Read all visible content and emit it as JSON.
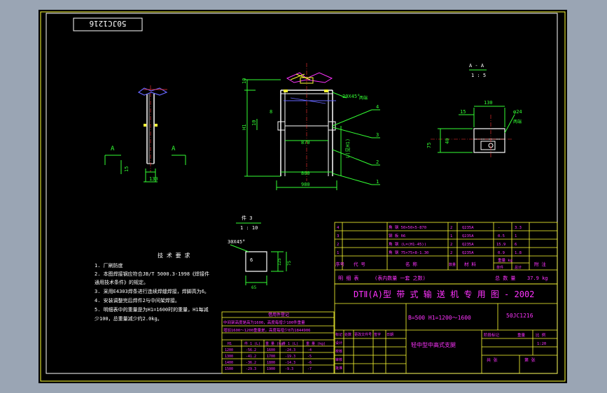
{
  "drawing_code_stamp": "50JC1216",
  "views": {
    "side_label_left": "A",
    "side_label_right": "A",
    "side_dim_15": "15",
    "side_dim_130": "130",
    "front_dim_10": "10",
    "front_dim_h1": "H1",
    "front_dim_10b": "10",
    "front_dim_8": "8",
    "front_dim_870": "870",
    "front_dim_800": "800",
    "front_dim_980": "980",
    "front_dim_chamfer": "20X45°",
    "front_dim_chamfer_note": "两端",
    "front_dim_l": "L(见H1)",
    "front_callouts": [
      "4",
      "3",
      "2",
      "1"
    ],
    "section_title": "A - A",
    "section_scale": "1 : 5",
    "section_dim_130": "130",
    "section_dim_15": "15",
    "section_dim_24": "φ24",
    "section_dim_24_note": "两端",
    "section_dim_75": "75",
    "section_dim_40": "40",
    "detail_title": "件 3",
    "detail_scale": "1 : 10",
    "detail_chamfer": "30X45°",
    "detail_dim_6": "6",
    "detail_dim_125": "125",
    "detail_dim_75": "75",
    "detail_dim_65": "65"
  },
  "notes": {
    "title": "技  术  要  求",
    "items": [
      "1. 厂刷防度",
      "2. 本图焊接钢应符合JB/T 5000.3-1998《焊接件",
      "   通用技术条件》的规定。",
      "3. 采用E4303焊条进行连续焊缝焊接，焊脚高为6。",
      "4. 安装调整完后焊件2与中间架焊接。",
      "5. 明细表中的重量是为H1=1600时的重量，H1每减",
      "   少100，总重量减少约2.0kg。"
    ]
  },
  "usage_table": {
    "title": "借用件登记",
    "rows": [
      "中间架高度是高为1600，高度每增少100件重量",
      "增加1600～1200重量是，高度每增少0为1844906"
    ],
    "headers": [
      "H1",
      "件 1 (L)",
      "重 量 (kg)",
      "件 1 (L)",
      "重 量 (kg)"
    ],
    "data": [
      [
        "1200",
        "-56.2",
        "1600",
        "-24.3",
        "-4"
      ],
      [
        "1300",
        "-41.2",
        "1700",
        "-19.3",
        "-5"
      ],
      [
        "1400",
        "-36.2",
        "1800",
        "-14.3",
        "-6"
      ],
      [
        "1500",
        "-29.3",
        "1900",
        "-9.3",
        "-7"
      ]
    ]
  },
  "bom": {
    "rows": [
      [
        "4",
        "角 钢 50×50×5-870",
        "2",
        "Q235A",
        "-",
        "3.3"
      ],
      [
        "3",
        "钢 板 δ6",
        "1",
        "Q235A",
        "0.5",
        "1"
      ],
      [
        "2",
        "角 钢 (L=(H1-45))",
        "2",
        "Q235A",
        "15.9",
        "6"
      ],
      [
        "1",
        "角 钢 75×75×8-1.30",
        "2",
        "Q235A",
        "0.9",
        "1.8"
      ]
    ],
    "header": [
      "序号",
      "代  号",
      "名    称",
      "数量",
      "材  料",
      "单件",
      "总计",
      "附  注"
    ],
    "weight_unit": "重量 kg",
    "list_label": "明  细  表",
    "list_note": "(表内数量  一套 之数)",
    "total_label": "总 数 量",
    "total_value": "37.9 kg"
  },
  "title_block": {
    "series_title": "DTⅡ(A)型  带 式 输 送 机 专 用 图 - 2002",
    "spec": "B=500 H1=1200～1600",
    "code": "50JC1216",
    "part_name": "轻中型中高式支腿",
    "scale_label": "比 例",
    "scale_value": "1:20",
    "sheet_total": "共  张",
    "sheet_num": "第  张",
    "row_labels": [
      "标记",
      "处数",
      "更改文件号",
      "签字",
      "日期"
    ],
    "sign_labels": [
      "设计",
      "校核",
      "审核",
      "批准"
    ],
    "stage_label": "阶段标记",
    "weight_label": "重量"
  },
  "colors": {
    "frame": "#ffffff",
    "border_outer": "#ffff33",
    "geometry": "#ffffff",
    "dimension": "#33ff33",
    "table_line": "#ffff33",
    "table_text": "#ff33ff",
    "hidden": "#ff3333",
    "section_blue": "#6666ff"
  }
}
